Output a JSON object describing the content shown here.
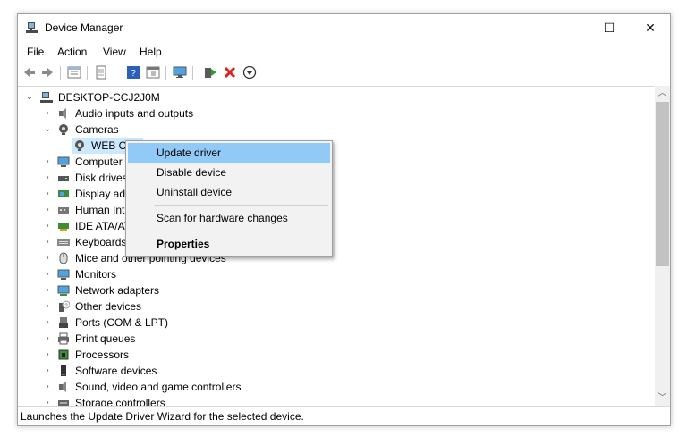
{
  "window": {
    "title": "Device Manager",
    "minimize": "—",
    "maximize": "☐",
    "close": "✕"
  },
  "menu": {
    "file": "File",
    "action": "Action",
    "view": "View",
    "help": "Help"
  },
  "toolbar": {
    "icons": [
      "back-arrow-icon",
      "forward-arrow-icon",
      "properties-grid-icon",
      "document-icon",
      "help-icon",
      "grid-view-icon",
      "monitor-icon",
      "update-driver-icon",
      "uninstall-x-icon",
      "download-circle-icon"
    ],
    "accent_green": "#2e9b2e",
    "accent_red": "#e0201a"
  },
  "tree": {
    "root": "DESKTOP-CCJ2J0M",
    "items": [
      {
        "label": "Audio inputs and outputs",
        "icon": "speaker-icon"
      },
      {
        "label": "Cameras",
        "icon": "camera-icon",
        "expanded": true
      },
      {
        "label": "WEB C...",
        "icon": "webcam-icon",
        "child": true,
        "selected": true
      },
      {
        "label": "Computer",
        "icon": "computer-icon"
      },
      {
        "label": "Disk drives",
        "icon": "disk-drive-icon"
      },
      {
        "label": "Display ad",
        "icon": "display-adapter-icon"
      },
      {
        "label": "Human Int",
        "icon": "human-interface-icon"
      },
      {
        "label": "IDE ATA/AT",
        "icon": "ide-controller-icon"
      },
      {
        "label": "Keyboards",
        "icon": "keyboard-icon"
      },
      {
        "label": "Mice and other pointing devices",
        "icon": "mouse-icon"
      },
      {
        "label": "Monitors",
        "icon": "monitor-icon"
      },
      {
        "label": "Network adapters",
        "icon": "network-adapter-icon"
      },
      {
        "label": "Other devices",
        "icon": "other-devices-icon"
      },
      {
        "label": "Ports (COM & LPT)",
        "icon": "ports-icon"
      },
      {
        "label": "Print queues",
        "icon": "printer-icon"
      },
      {
        "label": "Processors",
        "icon": "processor-icon"
      },
      {
        "label": "Software devices",
        "icon": "software-device-icon"
      },
      {
        "label": "Sound, video and game controllers",
        "icon": "sound-controller-icon"
      },
      {
        "label": "Storage controllers",
        "icon": "storage-controller-icon"
      }
    ]
  },
  "context_menu": {
    "update_driver": "Update driver",
    "disable_device": "Disable device",
    "uninstall_device": "Uninstall device",
    "scan": "Scan for hardware changes",
    "properties": "Properties",
    "highlight_color": "#91c9f7"
  },
  "status": {
    "text": "Launches the Update Driver Wizard for the selected device."
  }
}
